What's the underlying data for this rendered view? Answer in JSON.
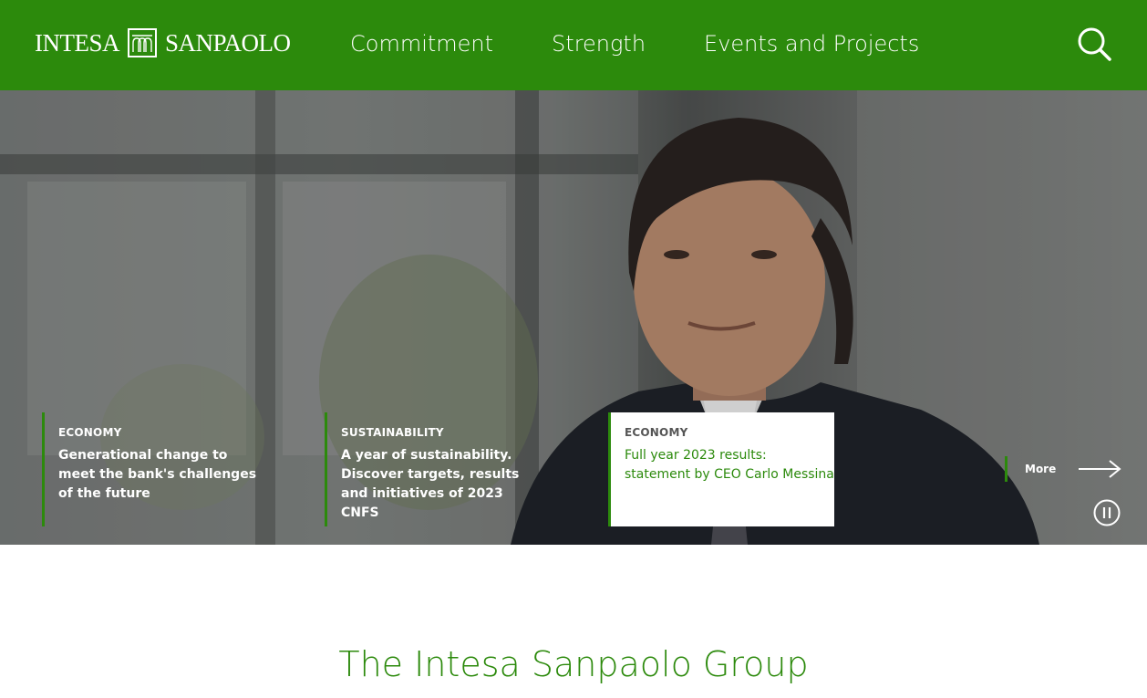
{
  "header": {
    "logo_left": "INTESA",
    "logo_right": "SANPAOLO",
    "nav": [
      "Commitment",
      "Strength",
      "Events and Projects"
    ],
    "search_icon": "search-icon"
  },
  "hero": {
    "slides": [
      {
        "category": "ECONOMY",
        "title": "Generational change to meet the bank's challenges of the future"
      },
      {
        "category": "SUSTAINABILITY",
        "title": "A year of sustainability. Discover targets, results and initiatives of 2023 CNFS"
      },
      {
        "category": "ECONOMY",
        "title": "Full year 2023 results: statement by CEO Carlo Messina"
      }
    ],
    "more_label": "More",
    "active_slide": 3
  },
  "section": {
    "title": "The Intesa Sanpaolo Group"
  },
  "colors": {
    "brand_green": "#2c8a0c",
    "white": "#ffffff"
  }
}
